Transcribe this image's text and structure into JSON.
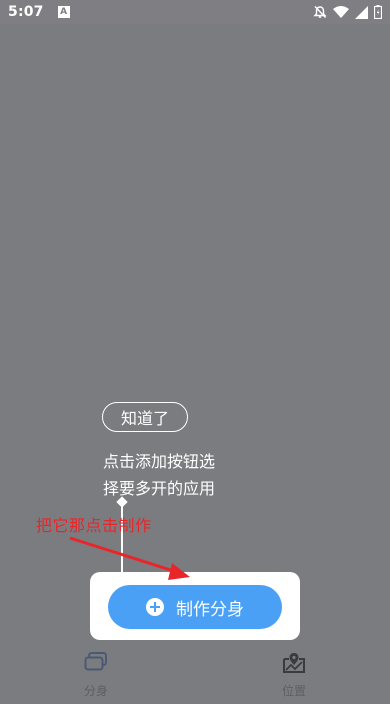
{
  "status_bar": {
    "time": "5:07",
    "notification_icon": "A",
    "icons": [
      "mute-bell-icon",
      "wifi-icon",
      "signal-icon",
      "battery-icon"
    ]
  },
  "guide": {
    "got_it_label": "知道了",
    "hint_line1": "点击添加按钮选",
    "hint_line2": "择要多开的应用"
  },
  "annotation": {
    "text": "把它那点击制作",
    "color": "#e8262a"
  },
  "main_action": {
    "label": "制作分身",
    "icon": "plus-circle-icon",
    "color": "#4aa0f5"
  },
  "bottom_nav": {
    "items": [
      {
        "label": "分身",
        "icon": "clone-cards-icon"
      },
      {
        "label": "位置",
        "icon": "map-pin-icon"
      }
    ]
  }
}
